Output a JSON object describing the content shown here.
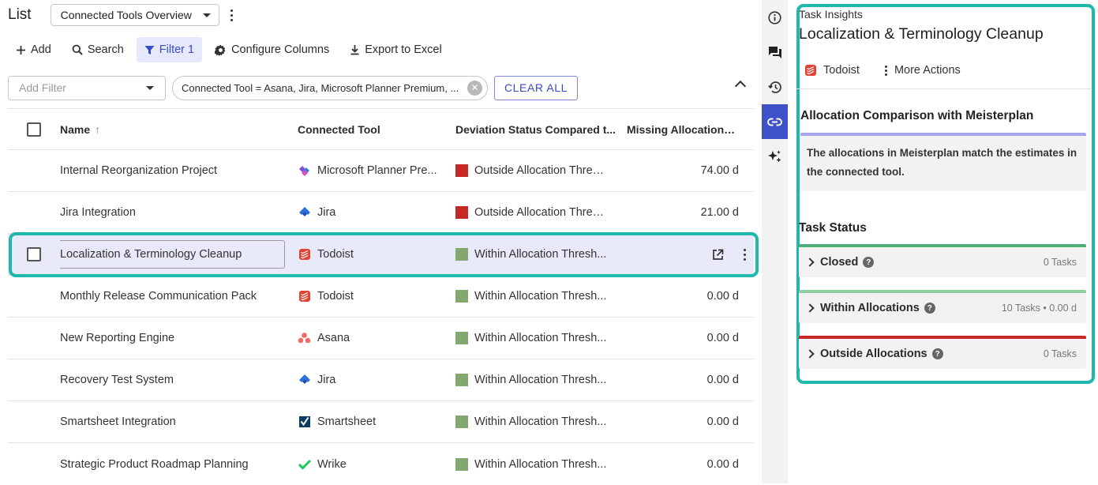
{
  "header": {
    "title": "List",
    "view_select": "Connected Tools Overview"
  },
  "toolbar": {
    "add": "Add",
    "search": "Search",
    "filter": "Filter",
    "filter_count": "1",
    "configure_columns": "Configure Columns",
    "export": "Export to Excel"
  },
  "filters": {
    "add_placeholder": "Add Filter",
    "chip_text": "Connected Tool = Asana, Jira, Microsoft Planner Premium, ...",
    "clear_all": "CLEAR ALL"
  },
  "table": {
    "columns": {
      "name": "Name",
      "tool": "Connected Tool",
      "deviation": "Deviation Status Compared t...",
      "missing": "Missing Allocations ..."
    },
    "rows": [
      {
        "name": "Internal Reorganization Project",
        "tool": "Microsoft Planner Pre...",
        "tool_icon": "planner-icon",
        "deviation": "Outside Allocation Thres...",
        "status_color": "#c62828",
        "missing": "74.00 d"
      },
      {
        "name": "Jira Integration",
        "tool": "Jira",
        "tool_icon": "jira-icon",
        "deviation": "Outside Allocation Thres...",
        "status_color": "#c62828",
        "missing": "21.00 d"
      },
      {
        "name": "Localization & Terminology Cleanup",
        "tool": "Todoist",
        "tool_icon": "todoist-icon",
        "deviation": "Within Allocation Thresh...",
        "status_color": "#82a870",
        "missing": ""
      },
      {
        "name": "Monthly Release Communication Pack",
        "tool": "Todoist",
        "tool_icon": "todoist-icon",
        "deviation": "Within Allocation Thresh...",
        "status_color": "#82a870",
        "missing": "0.00 d"
      },
      {
        "name": "New Reporting Engine",
        "tool": "Asana",
        "tool_icon": "asana-icon",
        "deviation": "Within Allocation Thresh...",
        "status_color": "#82a870",
        "missing": "0.00 d"
      },
      {
        "name": "Recovery Test System",
        "tool": "Jira",
        "tool_icon": "jira-icon",
        "deviation": "Within Allocation Thresh...",
        "status_color": "#82a870",
        "missing": "0.00 d"
      },
      {
        "name": "Smartsheet Integration",
        "tool": "Smartsheet",
        "tool_icon": "smartsheet-icon",
        "deviation": "Within Allocation Thresh...",
        "status_color": "#82a870",
        "missing": "0.00 d"
      },
      {
        "name": "Strategic Product Roadmap Planning",
        "tool": "Wrike",
        "tool_icon": "wrike-icon",
        "deviation": "Within Allocation Thresh...",
        "status_color": "#82a870",
        "missing": "0.00 d"
      }
    ]
  },
  "panel": {
    "eyebrow": "Task Insights",
    "title": "Localization & Terminology Cleanup",
    "tool_label": "Todoist",
    "more_actions": "More Actions",
    "comparison_title": "Allocation Comparison with Meisterplan",
    "comparison_note": "The allocations in Meisterplan match the estimates in the connected tool.",
    "task_status_title": "Task Status",
    "statuses": [
      {
        "label": "Closed",
        "count": "0 Tasks",
        "color": "#4caf7a"
      },
      {
        "label": "Within Allocations",
        "count": "10 Tasks • 0.00 d",
        "color": "#8fcf9f"
      },
      {
        "label": "Outside Allocations",
        "count": "0 Tasks",
        "color": "#c62828"
      }
    ]
  },
  "colors": {
    "accent": "#3f51c7",
    "highlight": "#1fb8ac"
  }
}
